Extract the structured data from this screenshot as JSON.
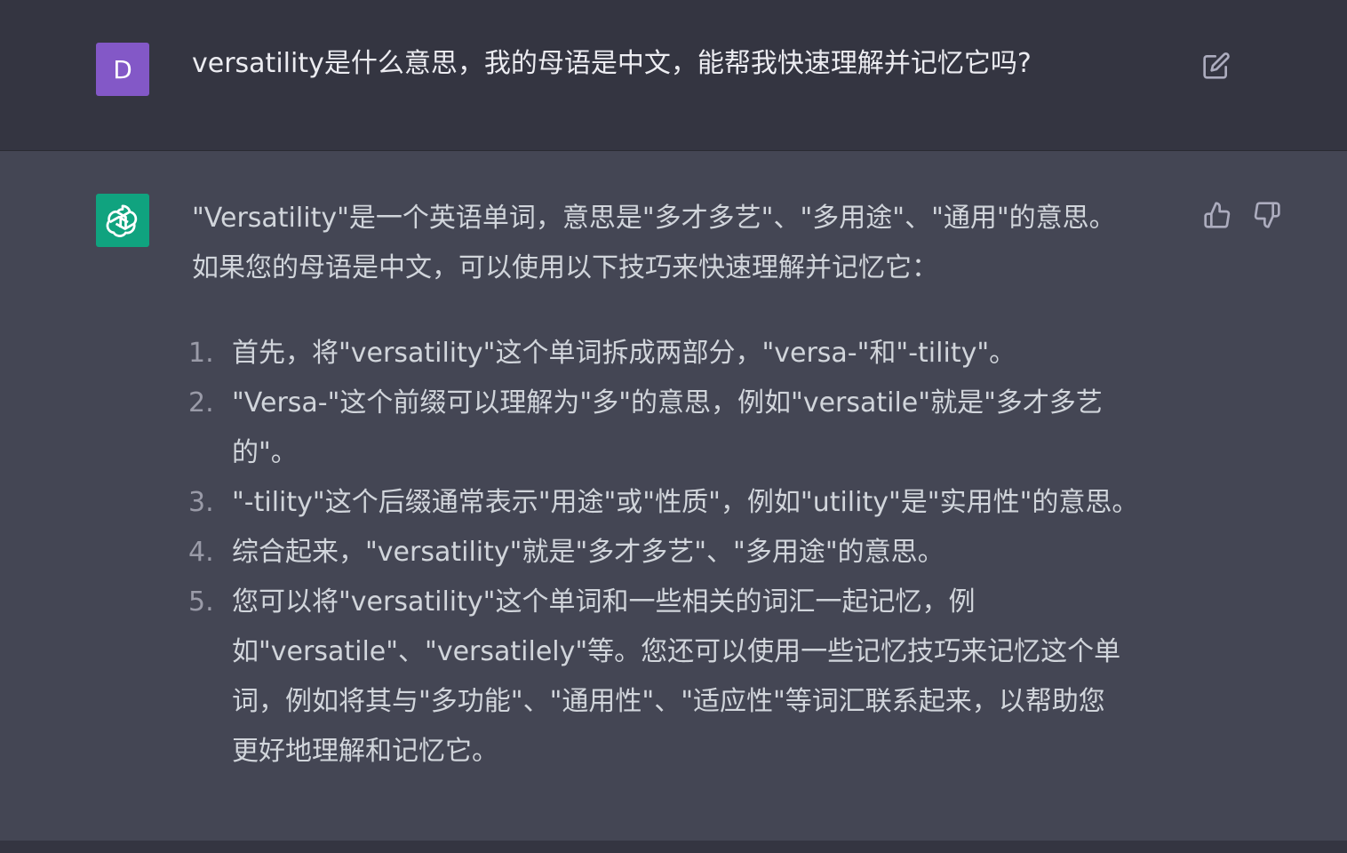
{
  "user_message": {
    "avatar_letter": "D",
    "avatar_color": "#8358c7",
    "text": "versatility是什么意思，我的母语是中文，能帮我快速理解并记忆它吗?",
    "edit_icon": "edit-icon"
  },
  "assistant_message": {
    "avatar_icon": "openai-logo-icon",
    "avatar_color": "#10a37f",
    "intro_lines": [
      "\"Versatility\"是一个英语单词，意思是\"多才多艺\"、\"多用途\"、\"通用\"的意思。",
      "如果您的母语是中文，可以使用以下技巧来快速理解并记忆它："
    ],
    "steps": [
      {
        "number": "1.",
        "lines": [
          "首先，将\"versatility\"这个单词拆成两部分，\"versa-\"和\"-tility\"。"
        ]
      },
      {
        "number": "2.",
        "lines": [
          "\"Versa-\"这个前缀可以理解为\"多\"的意思，例如\"versatile\"就是\"多才多艺",
          "的\"。"
        ]
      },
      {
        "number": "3.",
        "lines": [
          "\"-tility\"这个后缀通常表示\"用途\"或\"性质\"，例如\"utility\"是\"实用性\"的意思。"
        ]
      },
      {
        "number": "4.",
        "lines": [
          "综合起来，\"versatility\"就是\"多才多艺\"、\"多用途\"的意思。"
        ]
      },
      {
        "number": "5.",
        "lines": [
          "您可以将\"versatility\"这个单词和一些相关的词汇一起记忆，例",
          "如\"versatile\"、\"versatilely\"等。您还可以使用一些记忆技巧来记忆这个单",
          "词，例如将其与\"多功能\"、\"通用性\"、\"适应性\"等词汇联系起来，以帮助您",
          "更好地理解和记忆它。"
        ]
      }
    ],
    "feedback_icons": [
      "thumbs-up-icon",
      "thumbs-down-icon"
    ]
  }
}
